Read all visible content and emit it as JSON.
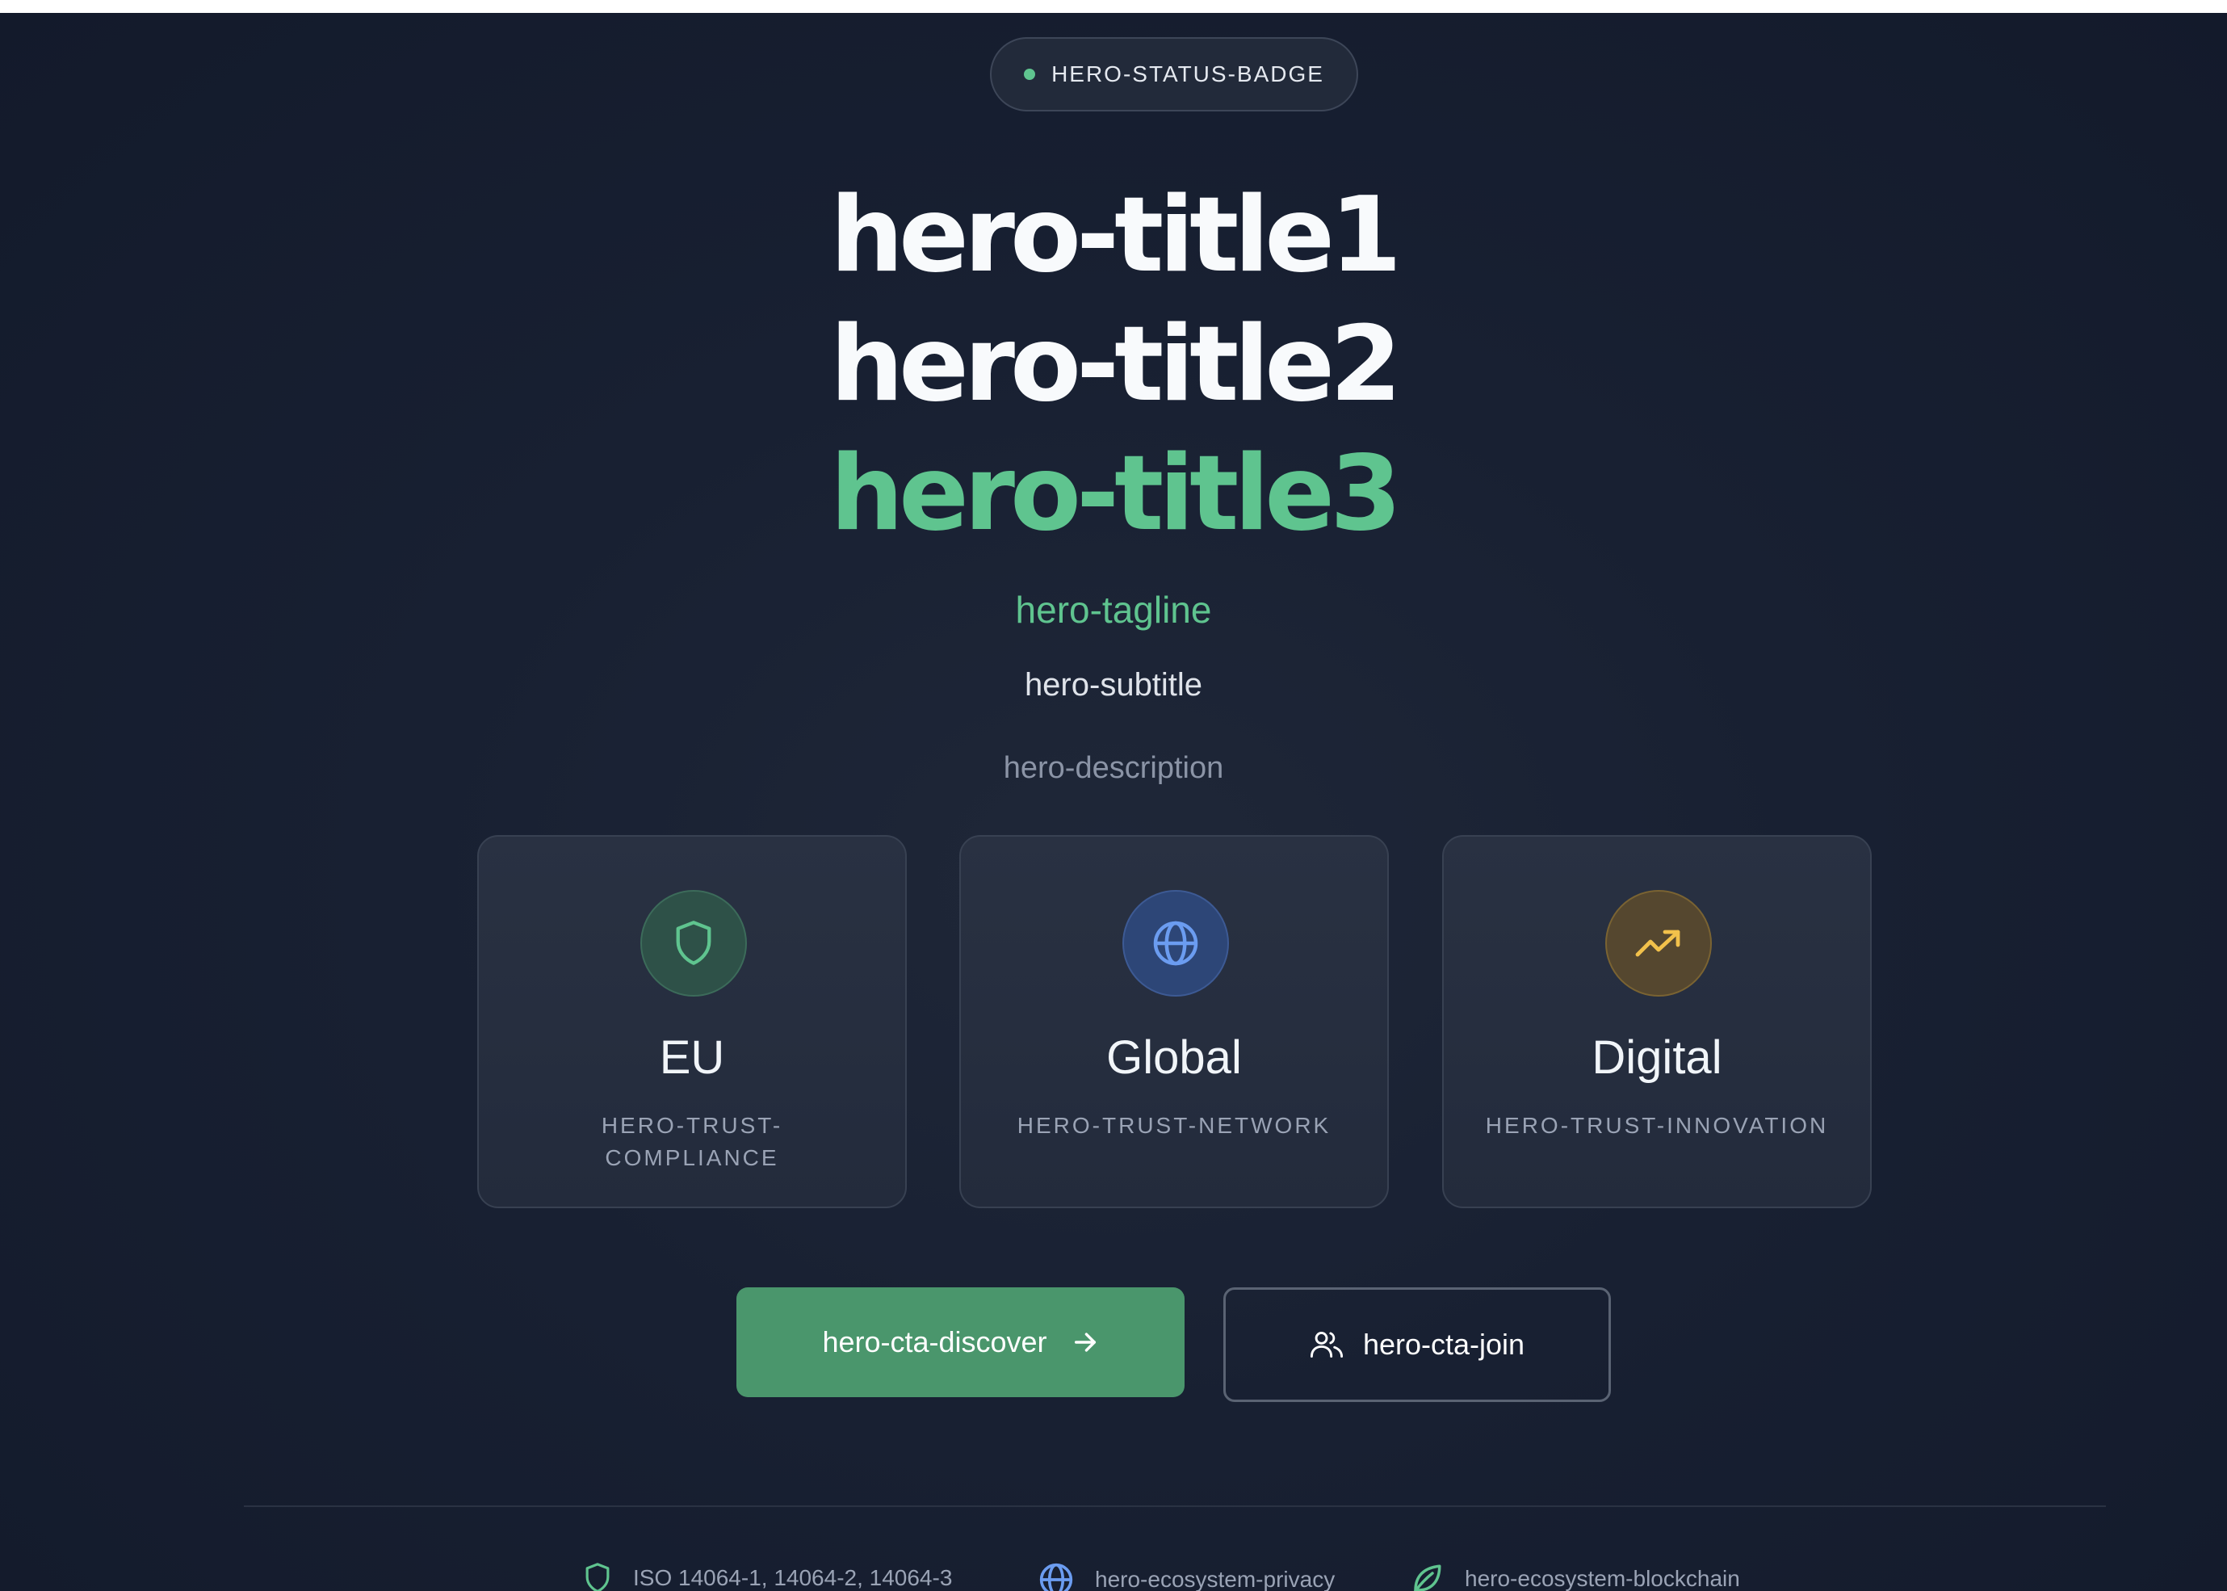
{
  "badge": {
    "label": "HERO-STATUS-BADGE",
    "dot_color": "#5fc48f"
  },
  "title": {
    "line1": "hero-title1",
    "line2": "hero-title2",
    "line3": "hero-title3"
  },
  "tagline": "hero-tagline",
  "subtitle": "hero-subtitle",
  "description": "hero-description",
  "cards": [
    {
      "icon": "shield-icon",
      "value": "EU",
      "label": "HERO-TRUST-COMPLIANCE",
      "accent": "#5fc48f"
    },
    {
      "icon": "globe-icon",
      "value": "Global",
      "label": "HERO-TRUST-NETWORK",
      "accent": "#6b9cf0"
    },
    {
      "icon": "trending-up-icon",
      "value": "Digital",
      "label": "HERO-TRUST-INNOVATION",
      "accent": "#f2c14b"
    }
  ],
  "cta": {
    "discover": {
      "label": "hero-cta-discover",
      "icon": "arrow-right-icon"
    },
    "join": {
      "label": "hero-cta-join",
      "icon": "users-icon"
    }
  },
  "ecosystem": [
    {
      "icon": "shield-icon",
      "label": "ISO 14064-1, 14064-2, 14064-3",
      "color": "#5fc48f"
    },
    {
      "icon": "globe-icon",
      "label": "hero-ecosystem-privacy",
      "color": "#6b9cf0"
    },
    {
      "icon": "leaf-icon",
      "label": "hero-ecosystem-blockchain",
      "color": "#5fc48f"
    }
  ],
  "colors": {
    "accent_green": "#5fc48f",
    "primary_button": "#4a966c",
    "background": "#182032"
  }
}
